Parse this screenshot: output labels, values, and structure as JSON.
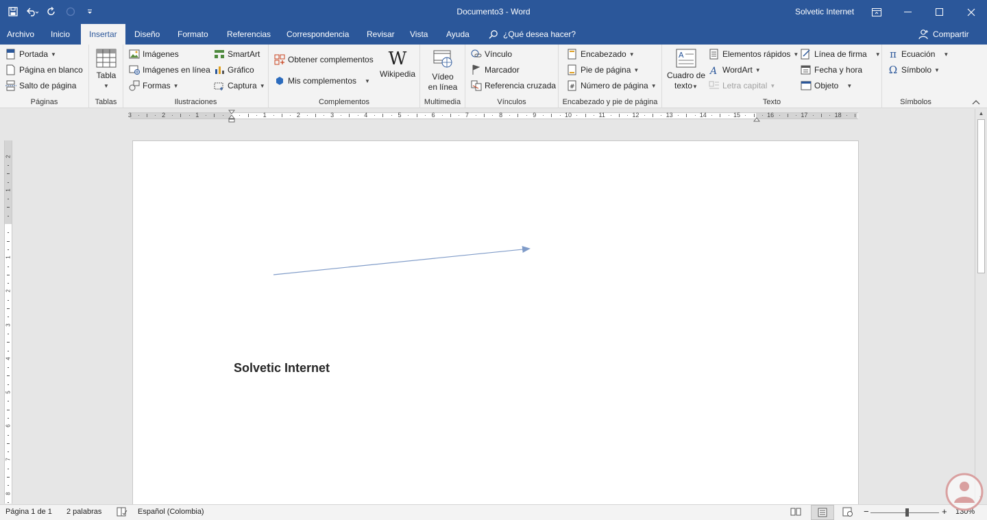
{
  "window": {
    "document_title": "Documento3  -  Word",
    "user": "Solvetic Internet"
  },
  "tabs": [
    "Archivo",
    "Inicio",
    "Insertar",
    "Diseño",
    "Formato",
    "Referencias",
    "Correspondencia",
    "Revisar",
    "Vista",
    "Ayuda"
  ],
  "active_tab": "Insertar",
  "tell_me": "¿Qué desea hacer?",
  "share_label": "Compartir",
  "ribbon": {
    "paginas": {
      "label": "Páginas",
      "items": [
        "Portada",
        "Página en blanco",
        "Salto de página"
      ]
    },
    "tablas": {
      "label": "Tablas",
      "tabla": "Tabla"
    },
    "ilustraciones": {
      "label": "Ilustraciones",
      "items": [
        "Imágenes",
        "Imágenes en línea",
        "Formas",
        "SmartArt",
        "Gráfico",
        "Captura"
      ]
    },
    "complementos": {
      "label": "Complementos",
      "obtener": "Obtener complementos",
      "mis": "Mis complementos",
      "wikipedia": "Wikipedia"
    },
    "multimedia": {
      "label": "Multimedia",
      "video1": "Vídeo",
      "video2": "en línea"
    },
    "vinculos": {
      "label": "Vínculos",
      "items": [
        "Vínculo",
        "Marcador",
        "Referencia cruzada"
      ]
    },
    "encabezado": {
      "label": "Encabezado y pie de página",
      "items": [
        "Encabezado",
        "Pie de página",
        "Número de página"
      ]
    },
    "texto": {
      "label": "Texto",
      "cuadro1": "Cuadro de",
      "cuadro2": "texto",
      "items": [
        "Elementos rápidos",
        "WordArt",
        "Letra capital",
        "Línea de firma",
        "Fecha y hora",
        "Objeto"
      ]
    },
    "simbolos": {
      "label": "Símbolos",
      "items": [
        "Ecuación",
        "Símbolo"
      ]
    }
  },
  "ruler_numbers": [
    "3",
    "2",
    "1",
    "1",
    "2",
    "3",
    "4",
    "5",
    "6",
    "7",
    "8",
    "9",
    "10",
    "11",
    "12",
    "13",
    "14",
    "15",
    "16",
    "17",
    "18"
  ],
  "vruler_numbers": [
    "2",
    "1",
    "1",
    "2",
    "3",
    "4",
    "5",
    "6",
    "7",
    "8"
  ],
  "document": {
    "text": "Solvetic Internet"
  },
  "status": {
    "page": "Página 1 de 1",
    "words": "2 palabras",
    "language": "Español (Colombia)",
    "zoom": "130%"
  },
  "colors": {
    "accent": "#2b579a",
    "arrow": "#7f9bc8"
  }
}
